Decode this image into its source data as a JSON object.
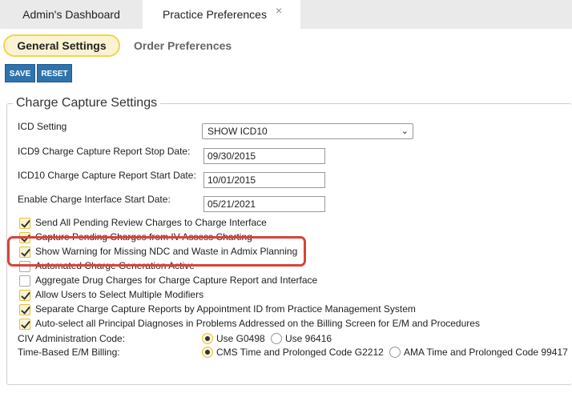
{
  "top_tabs": {
    "admin_dashboard": "Admin's Dashboard",
    "practice_preferences": "Practice Preferences",
    "close_glyph": "×"
  },
  "sub_tabs": {
    "general": "General Settings",
    "order": "Order Preferences"
  },
  "toolbar": {
    "save": "SAVE",
    "reset": "RESET"
  },
  "section": {
    "title": "Charge Capture Settings",
    "icd_setting_label": "ICD Setting",
    "icd_setting_value": "SHOW ICD10",
    "icd9_stop_label": "ICD9 Charge Capture Report Stop Date:",
    "icd9_stop_value": "09/30/2015",
    "icd10_start_label": "ICD10 Charge Capture Report Start Date:",
    "icd10_start_value": "10/01/2015",
    "charge_interface_label": "Enable Charge Interface Start Date:",
    "charge_interface_value": "05/21/2021",
    "checkboxes": [
      {
        "label": "Send All Pending Review Charges to Charge Interface",
        "checked": true
      },
      {
        "label": "Capture Pending Charges from IV Assess Charting",
        "checked": true
      },
      {
        "label": "Show Warning for Missing NDC and Waste in Admix Planning",
        "checked": true
      },
      {
        "label": "Automated Charge Generation Active",
        "checked": false
      },
      {
        "label": "Aggregate Drug Charges for Charge Capture Report and Interface",
        "checked": false
      },
      {
        "label": "Allow Users to Select Multiple Modifiers",
        "checked": true
      },
      {
        "label": "Separate Charge Capture Reports by Appointment ID from Practice Management System",
        "checked": true
      },
      {
        "label": "Auto-select all Principal Diagnoses in Problems Addressed on the Billing Screen for E/M and Procedures",
        "checked": true
      }
    ],
    "civ_label": "CIV Administration Code:",
    "civ_options": [
      "Use G0498",
      "Use 96416"
    ],
    "em_label": "Time-Based E/M Billing:",
    "em_options": [
      "CMS Time and Prolonged Code G2212",
      "AMA Time and Prolonged Code 99417"
    ]
  },
  "colors": {
    "accent_yellow": "#f5d34a",
    "button_blue": "#2f73ad",
    "highlight_red": "#d8433a"
  }
}
